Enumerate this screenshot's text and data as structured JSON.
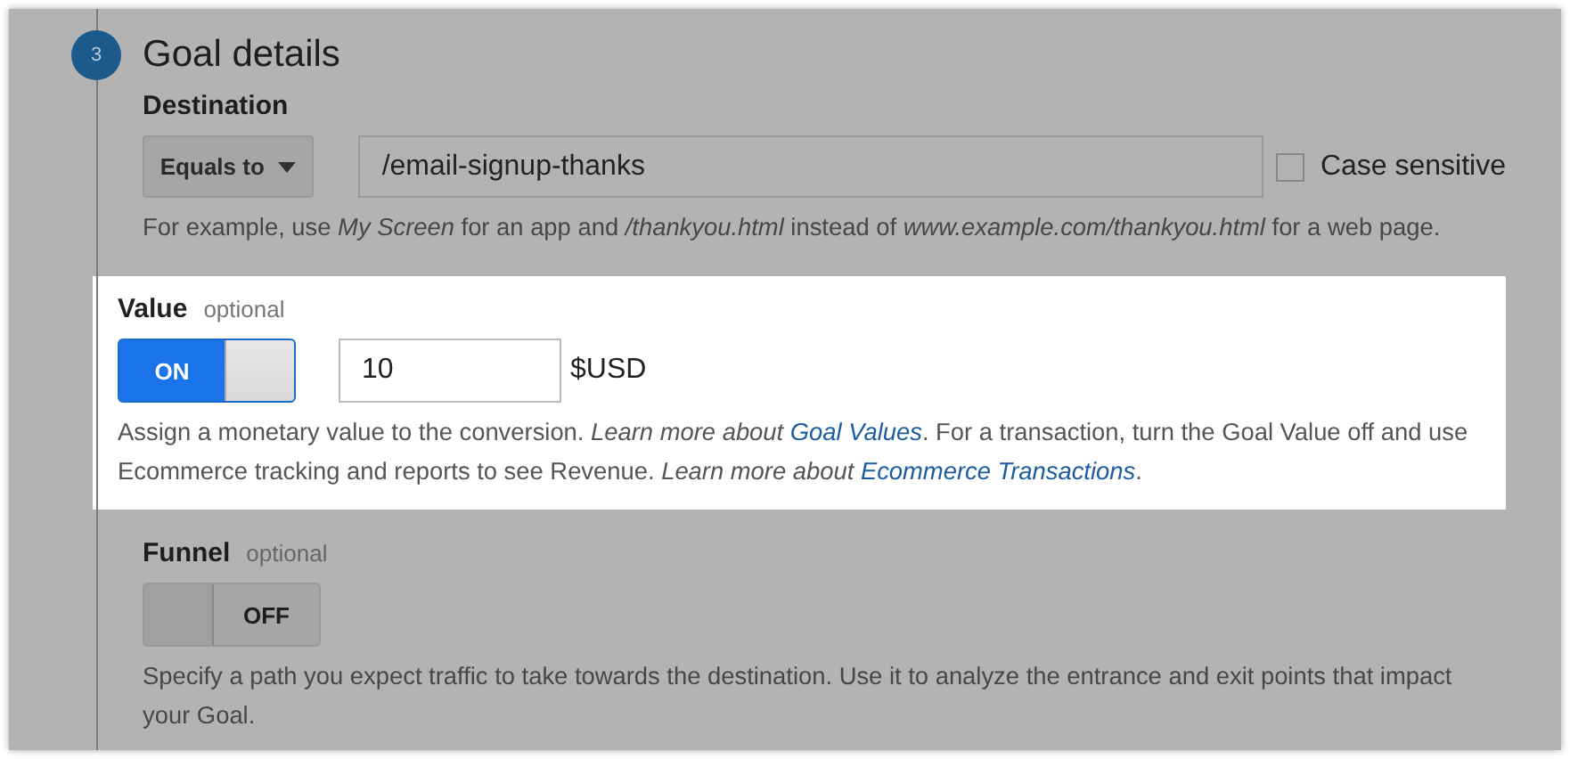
{
  "step": {
    "number": "3",
    "title": "Goal details"
  },
  "destination": {
    "label": "Destination",
    "match": "Equals to",
    "value": "/email-signup-thanks",
    "case_sensitive": {
      "label": "Case sensitive",
      "checked": false
    },
    "help": [
      {
        "kind": "plain",
        "text": "For example, use "
      },
      {
        "kind": "italic",
        "text": "My Screen"
      },
      {
        "kind": "plain",
        "text": " for an app and "
      },
      {
        "kind": "italic",
        "text": "/thankyou.html"
      },
      {
        "kind": "plain",
        "text": " instead of "
      },
      {
        "kind": "italic",
        "text": "www.example.com/thankyou.html"
      },
      {
        "kind": "plain",
        "text": " for a web page."
      }
    ]
  },
  "sections": [
    {
      "label": "Value",
      "optional": "optional",
      "highlighted": true,
      "toggle": {
        "on": true,
        "label": "ON"
      },
      "amount": "10",
      "unit": "$USD",
      "help": [
        {
          "kind": "plain",
          "text": "Assign a monetary value to the conversion. "
        },
        {
          "kind": "italic",
          "text": "Learn more about "
        },
        {
          "kind": "link",
          "text": "Goal Values"
        },
        {
          "kind": "plain",
          "text": ". For a transaction, turn the Goal Value off and use Ecommerce tracking and reports to see Revenue. "
        },
        {
          "kind": "italic",
          "text": "Learn more about "
        },
        {
          "kind": "link",
          "text": "Ecommerce Transactions"
        },
        {
          "kind": "plain",
          "text": "."
        }
      ]
    },
    {
      "label": "Funnel",
      "optional": "optional",
      "highlighted": false,
      "toggle": {
        "on": false,
        "label": "OFF"
      },
      "help": [
        {
          "kind": "plain",
          "text": "Specify a path you expect traffic to take towards the destination. Use it to analyze the entrance and exit points that impact your Goal."
        }
      ]
    }
  ]
}
